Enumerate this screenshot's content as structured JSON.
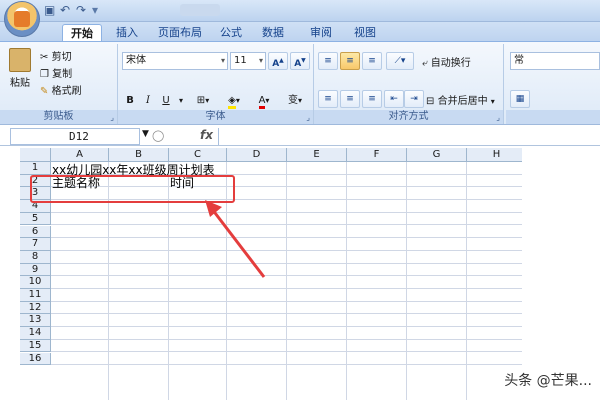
{
  "quick_access": {
    "save_icon": "save-icon",
    "undo_icon": "undo-icon",
    "redo_icon": "redo-icon"
  },
  "tabs": [
    {
      "label": "开始",
      "active": true
    },
    {
      "label": "插入"
    },
    {
      "label": "页面布局"
    },
    {
      "label": "公式"
    },
    {
      "label": "数据"
    },
    {
      "label": "审阅"
    },
    {
      "label": "视图"
    }
  ],
  "ribbon": {
    "clipboard": {
      "paste": "粘贴",
      "cut": "剪切",
      "copy": "复制",
      "format_painter": "格式刷",
      "title": "剪贴板"
    },
    "font": {
      "name": "宋体",
      "size": "11",
      "grow": "A",
      "shrink": "A",
      "bold": "B",
      "italic": "I",
      "underline": "U",
      "phonetic": "变",
      "title": "字体"
    },
    "alignment": {
      "wrap": "自动换行",
      "merge": "合并后居中",
      "title": "对齐方式"
    },
    "number": {
      "format": "常"
    }
  },
  "formula_bar": {
    "name_box": "D12",
    "fx": "fx",
    "value": ""
  },
  "columns": [
    "A",
    "B",
    "C",
    "D",
    "E",
    "F",
    "G",
    "H"
  ],
  "rows": [
    "1",
    "2",
    "3",
    "4",
    "5",
    "6",
    "7",
    "8",
    "9",
    "10",
    "11",
    "12",
    "13",
    "14",
    "15",
    "16"
  ],
  "cells": {
    "A1": "xx幼儿园xx年xx班级周计划表",
    "A2": "主题名称",
    "C2": "时间"
  },
  "watermark": "头条 @芒果..."
}
